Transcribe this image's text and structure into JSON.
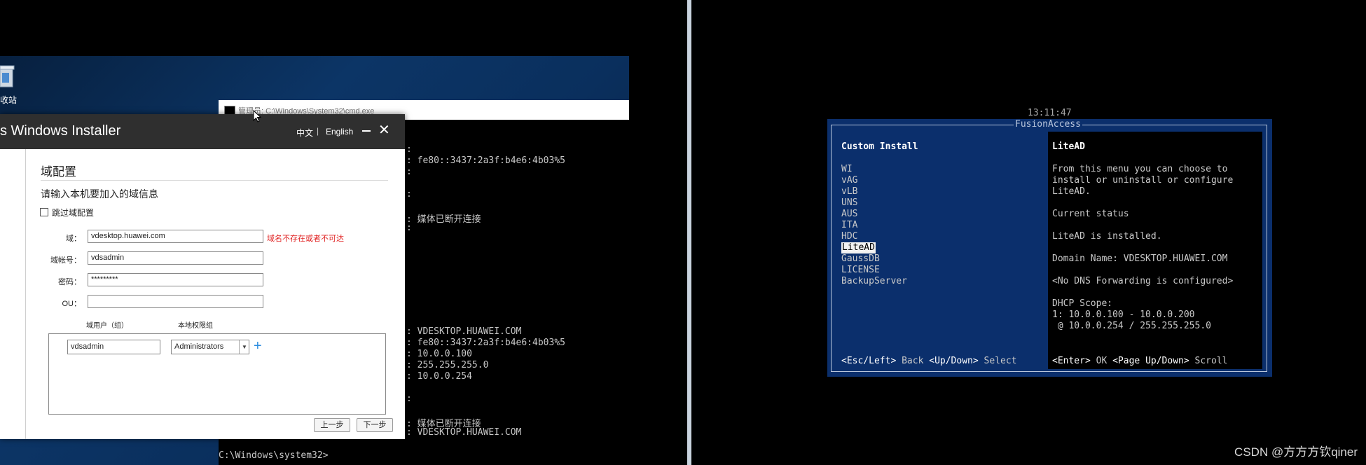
{
  "left": {
    "desktop": {
      "recycle_label": "收站"
    },
    "cmd": {
      "title": "管理员: C:\\Windows\\System32\\cmd.exe",
      "lines": [
        ":",
        ": fe80::3437:2a3f:b4e6:4b03%5",
        ":",
        ":",
        ": 媒体已断开连接",
        ":",
        ": VDESKTOP.HUAWEI.COM",
        ": fe80::3437:2a3f:b4e6:4b03%5",
        ": 10.0.0.100",
        ": 255.255.255.0",
        ": 10.0.0.254",
        ":",
        ": 媒体已断开连接",
        ": VDESKTOP.HUAWEI.COM"
      ],
      "prompt": "C:\\Windows\\system32>"
    },
    "installer": {
      "title": "s Windows Installer",
      "lang_zh": "中文",
      "lang_sep": "|",
      "lang_en": "English",
      "section_title": "域配置",
      "instruction": "请输入本机要加入的域信息",
      "skip_label": "跳过域配置",
      "domain_label": "域：",
      "domain_value": "vdesktop.huawei.com",
      "domain_error": "域名不存在或者不可达",
      "account_label": "域帐号：",
      "account_value": "vdsadmin",
      "password_label": "密码：",
      "password_value": "*********",
      "ou_label": "OU：",
      "ou_value": "",
      "col_user": "域用户（组）",
      "col_group": "本地权限组",
      "group_user_value": "vdsadmin",
      "group_select_value": "Administrators",
      "prev_label": "上一步",
      "next_label": "下一步"
    }
  },
  "right": {
    "clock": "13:11:47",
    "title": "FusionAccess",
    "left_heading": "Custom Install",
    "menu": [
      "WI",
      "vAG",
      "vLB",
      "UNS",
      "AUS",
      "ITA",
      "HDC",
      "LiteAD",
      "GaussDB",
      "LICENSE",
      "BackupServer"
    ],
    "selected_index": 7,
    "right_heading": "LiteAD",
    "desc_lines": [
      "From this menu you can choose to",
      "install or uninstall or configure",
      "LiteAD."
    ],
    "status_heading": "Current status",
    "status_line": "LiteAD is installed.",
    "domain_line": "Domain Name: VDESKTOP.HUAWEI.COM",
    "dns_line": "<No DNS Forwarding is configured>",
    "dhcp_heading": "DHCP Scope:",
    "dhcp_line1": "1: 10.0.0.100 - 10.0.0.200",
    "dhcp_line2": " @ 10.0.0.254 / 255.255.255.0",
    "footer_left": {
      "k1": "<Esc/Left>",
      "t1": " Back ",
      "k2": "<Up/Down>",
      "t2": " Select"
    },
    "footer_right": {
      "k1": "<Enter>",
      "t1": " OK ",
      "k2": "<Page Up/Down>",
      "t2": " Scroll"
    }
  },
  "watermark": "CSDN @方方方钦qiner"
}
